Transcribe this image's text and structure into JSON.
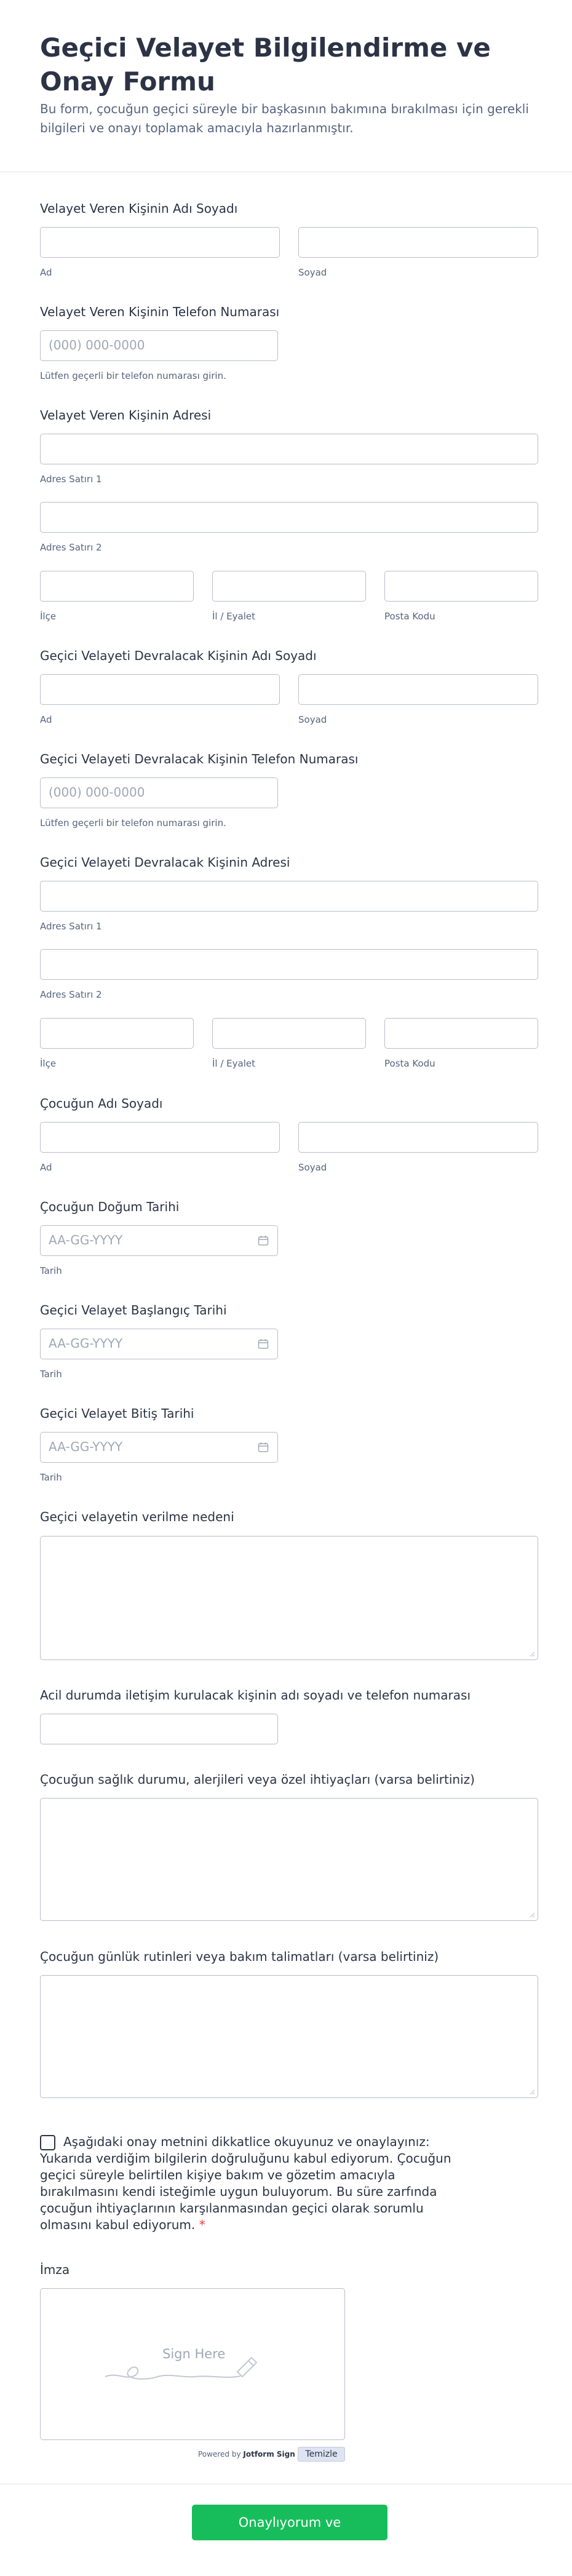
{
  "header": {
    "title": "Geçici Velayet Bilgilendirme ve Onay Formu",
    "description": "Bu form, çocuğun geçici süreyle bir başkasının bakımına bırakılması için gerekli bilgileri ve onayı toplamak amacıyla hazırlanmıştır."
  },
  "giver_name": {
    "label": "Velayet Veren Kişinin Adı Soyadı",
    "first": "Ad",
    "last": "Soyad"
  },
  "giver_phone": {
    "label": "Velayet Veren Kişinin Telefon Numarası",
    "placeholder": "(000) 000-0000",
    "help": "Lütfen geçerli bir telefon numarası girin."
  },
  "giver_address": {
    "label": "Velayet Veren Kişinin Adresi",
    "line1": "Adres Satırı 1",
    "line2": "Adres Satırı 2",
    "district": "İlçe",
    "province": "İl / Eyalet",
    "postal": "Posta Kodu"
  },
  "receiver_name": {
    "label": "Geçici Velayeti Devralacak Kişinin Adı Soyadı",
    "first": "Ad",
    "last": "Soyad"
  },
  "receiver_phone": {
    "label": "Geçici Velayeti Devralacak Kişinin Telefon Numarası",
    "placeholder": "(000) 000-0000",
    "help": "Lütfen geçerli bir telefon numarası girin."
  },
  "receiver_address": {
    "label": "Geçici Velayeti Devralacak Kişinin Adresi",
    "line1": "Adres Satırı 1",
    "line2": "Adres Satırı 2",
    "district": "İlçe",
    "province": "İl / Eyalet",
    "postal": "Posta Kodu"
  },
  "child_name": {
    "label": "Çocuğun Adı Soyadı",
    "first": "Ad",
    "last": "Soyad"
  },
  "child_birth": {
    "label": "Çocuğun Doğum Tarihi",
    "placeholder": "AA-GG-YYYY",
    "sub": "Tarih"
  },
  "start_date": {
    "label": "Geçici Velayet Başlangıç Tarihi",
    "placeholder": "AA-GG-YYYY",
    "sub": "Tarih"
  },
  "end_date": {
    "label": "Geçici Velayet Bitiş Tarihi",
    "placeholder": "AA-GG-YYYY",
    "sub": "Tarih"
  },
  "reason": {
    "label": "Geçici velayetin verilme nedeni"
  },
  "emergency": {
    "label": "Acil durumda iletişim kurulacak kişinin adı soyadı ve telefon numarası"
  },
  "health": {
    "label": "Çocuğun sağlık durumu, alerjileri veya özel ihtiyaçları (varsa belirtiniz)"
  },
  "routine": {
    "label": "Çocuğun günlük rutinleri veya bakım talimatları (varsa belirtiniz)"
  },
  "consent": {
    "text": "Aşağıdaki onay metnini dikkatlice okuyunuz ve onaylayınız: Yukarıda verdiğim bilgilerin doğruluğunu kabul ediyorum. Çocuğun geçici süreyle belirtilen kişiye bakım ve gözetim amacıyla bırakılmasını kendi isteğimle uygun buluyorum. Bu süre zarfında çocuğun ihtiyaçlarının karşılanmasından geçici olarak sorumlu olmasını kabul ediyorum.",
    "required_mark": "*"
  },
  "signature": {
    "label": "İmza",
    "hint": "Sign Here",
    "powered_prefix": "Powered by ",
    "powered_brand": "Jotform Sign",
    "clear": "Temizle"
  },
  "submit": {
    "label": "Onaylıyorum ve Gönderiyorum"
  },
  "colors": {
    "accent": "#18bd5b",
    "text": "#2c3345",
    "muted": "#57647e",
    "border": "#b8bdc9"
  }
}
